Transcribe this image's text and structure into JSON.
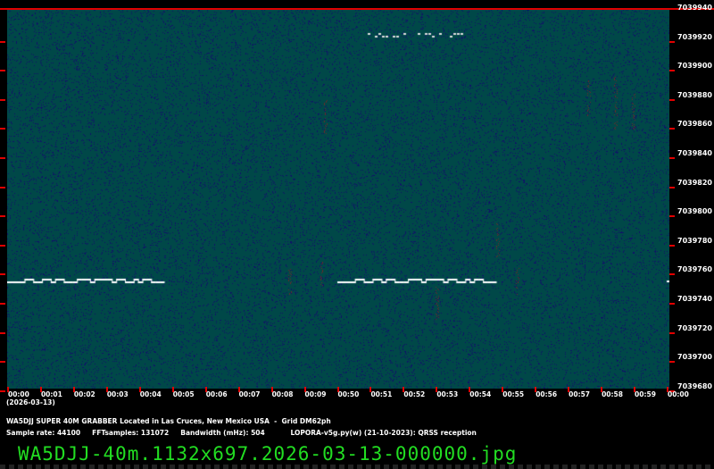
{
  "y_axis_labels": [
    "7039940",
    "7039920",
    "7039900",
    "7039880",
    "7039860",
    "7039840",
    "7039820",
    "7039800",
    "7039780",
    "7039760",
    "7039740",
    "7039720",
    "7039700",
    "7039680"
  ],
  "x_axis_labels": [
    "00:00",
    "00:01",
    "00:02",
    "00:03",
    "00:04",
    "00:05",
    "00:06",
    "00:07",
    "00:08",
    "00:09",
    "00:50",
    "00:51",
    "00:52",
    "00:53",
    "00:54",
    "00:55",
    "00:56",
    "00:57",
    "00:58",
    "00:59",
    "00:00"
  ],
  "date": "(2026-03-13)",
  "info_line1": "WA5DJJ SUPER 40M GRABBER Located in Las Cruces, New Mexico USA  -  Grid DM62ph",
  "info_line2": "Sample rate: 44100     FFTsamples: 131072     Bandwidth (mHz): 504           LOPORA-v5g.py(w) (21-10-2023): QRSS reception",
  "filename": "WA5DJJ-40m.1132x697.2026-03-13-000000.jpg",
  "colors": {
    "background": "#004848",
    "noise": "#10106a",
    "signal": "#ffffff",
    "accent": "#e00000",
    "filename": "#22dd22"
  }
}
